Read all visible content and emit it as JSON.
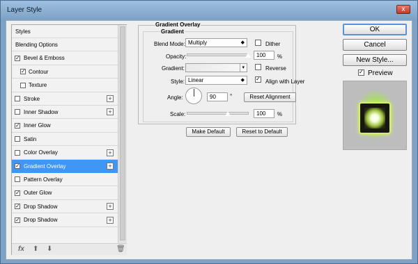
{
  "window": {
    "title": "Layer Style",
    "close_glyph": "x"
  },
  "styles_list": {
    "items": [
      {
        "label": "Styles",
        "has_checkbox": false,
        "checked": false,
        "sub": false,
        "plus": false,
        "selected": false
      },
      {
        "label": "Blending Options",
        "has_checkbox": false,
        "checked": false,
        "sub": false,
        "plus": false,
        "selected": false
      },
      {
        "label": "Bevel & Emboss",
        "has_checkbox": true,
        "checked": true,
        "sub": false,
        "plus": false,
        "selected": false
      },
      {
        "label": "Contour",
        "has_checkbox": true,
        "checked": true,
        "sub": true,
        "plus": false,
        "selected": false
      },
      {
        "label": "Texture",
        "has_checkbox": true,
        "checked": false,
        "sub": true,
        "plus": false,
        "selected": false
      },
      {
        "label": "Stroke",
        "has_checkbox": true,
        "checked": false,
        "sub": false,
        "plus": true,
        "selected": false
      },
      {
        "label": "Inner Shadow",
        "has_checkbox": true,
        "checked": false,
        "sub": false,
        "plus": true,
        "selected": false
      },
      {
        "label": "Inner Glow",
        "has_checkbox": true,
        "checked": true,
        "sub": false,
        "plus": false,
        "selected": false
      },
      {
        "label": "Satin",
        "has_checkbox": true,
        "checked": false,
        "sub": false,
        "plus": false,
        "selected": false
      },
      {
        "label": "Color Overlay",
        "has_checkbox": true,
        "checked": false,
        "sub": false,
        "plus": true,
        "selected": false
      },
      {
        "label": "Gradient Overlay",
        "has_checkbox": true,
        "checked": true,
        "sub": false,
        "plus": true,
        "selected": true
      },
      {
        "label": "Pattern Overlay",
        "has_checkbox": true,
        "checked": false,
        "sub": false,
        "plus": false,
        "selected": false
      },
      {
        "label": "Outer Glow",
        "has_checkbox": true,
        "checked": true,
        "sub": false,
        "plus": false,
        "selected": false
      },
      {
        "label": "Drop Shadow",
        "has_checkbox": true,
        "checked": true,
        "sub": false,
        "plus": true,
        "selected": false
      },
      {
        "label": "Drop Shadow",
        "has_checkbox": true,
        "checked": true,
        "sub": false,
        "plus": true,
        "selected": false
      }
    ],
    "fx_label": "fx",
    "icons": [
      "fx-icon",
      "move-up-icon",
      "move-down-icon",
      "trash-icon"
    ]
  },
  "gradient_overlay": {
    "title": "Gradient Overlay",
    "subtitle": "Gradient",
    "blend_mode_label": "Blend Mode:",
    "blend_mode_value": "Multiply",
    "dither_label": "Dither",
    "dither_checked": false,
    "opacity_label": "Opacity:",
    "opacity_value": "100",
    "opacity_unit": "%",
    "opacity_level": 1.0,
    "gradient_label": "Gradient:",
    "reverse_label": "Reverse",
    "reverse_checked": false,
    "style_label": "Style:",
    "style_value": "Linear",
    "align_label": "Align with Layer",
    "align_checked": true,
    "angle_label": "Angle:",
    "angle_value": "90",
    "angle_unit": "°",
    "reset_alignment_label": "Reset Alignment",
    "scale_label": "Scale:",
    "scale_value": "100",
    "scale_unit": "%",
    "scale_level": 0.67,
    "make_default_label": "Make Default",
    "reset_default_label": "Reset to Default"
  },
  "actions": {
    "ok_label": "OK",
    "cancel_label": "Cancel",
    "new_style_label": "New Style...",
    "preview_label": "Preview",
    "preview_checked": true
  },
  "colors": {
    "selection": "#3f96f5",
    "preview_glow": "#c8f087",
    "tile_border": "#d6ef65",
    "window_frame": "#7ea2c6"
  }
}
